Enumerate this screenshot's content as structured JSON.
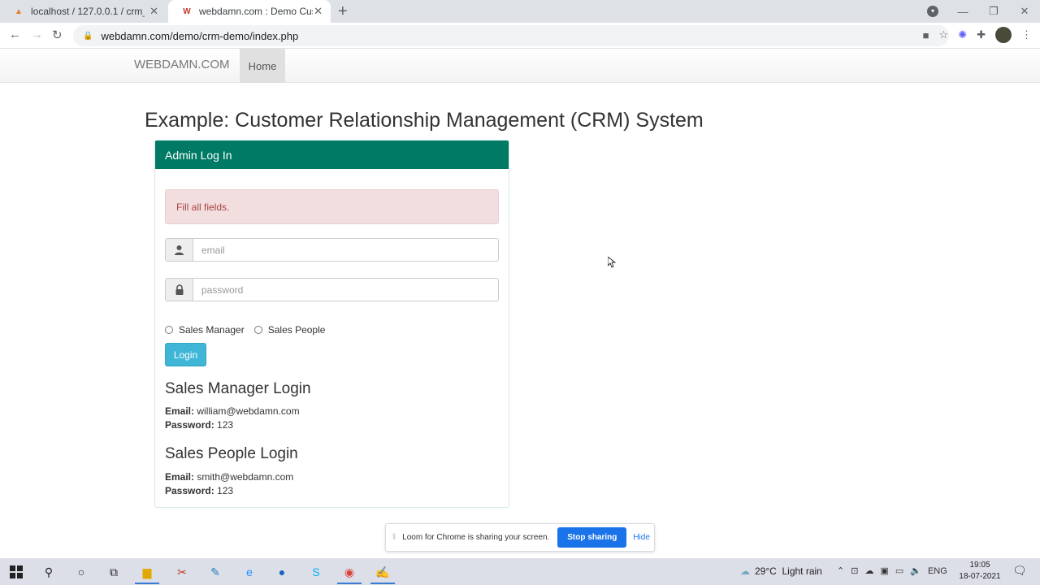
{
  "browser": {
    "tabs": [
      {
        "title": "localhost / 127.0.0.1 / crm_system",
        "active": false
      },
      {
        "title": "webdamn.com : Demo Customer",
        "active": true
      }
    ],
    "new_tab_label": "+",
    "url": "webdamn.com/demo/crm-demo/index.php"
  },
  "navbar": {
    "brand": "WEBDAMN.COM",
    "home": "Home"
  },
  "page": {
    "title": "Example: Customer Relationship Management (CRM) System"
  },
  "login_panel": {
    "heading": "Admin Log In",
    "alert": "Fill all fields.",
    "email_placeholder": "email",
    "password_placeholder": "password",
    "roles": [
      "Sales Manager",
      "Sales People"
    ],
    "login_label": "Login",
    "manager": {
      "heading": "Sales Manager Login",
      "email_label": "Email:",
      "email": "william@webdamn.com",
      "password_label": "Password:",
      "password": "123"
    },
    "people": {
      "heading": "Sales People Login",
      "email_label": "Email:",
      "email": "smith@webdamn.com",
      "password_label": "Password:",
      "password": "123"
    }
  },
  "loom_bar": {
    "message": "Loom for Chrome is sharing your screen.",
    "stop_label": "Stop sharing",
    "hide_label": "Hide"
  },
  "taskbar": {
    "weather": "29°C  Light rain",
    "language": "ENG",
    "time": "19:05",
    "date": "18-07-2021"
  },
  "colors": {
    "panel_heading": "#007a64",
    "alert_bg": "#f2dede",
    "alert_text": "#a94442",
    "login_button": "#3fb6d6",
    "loom_stop": "#1a73e8"
  }
}
